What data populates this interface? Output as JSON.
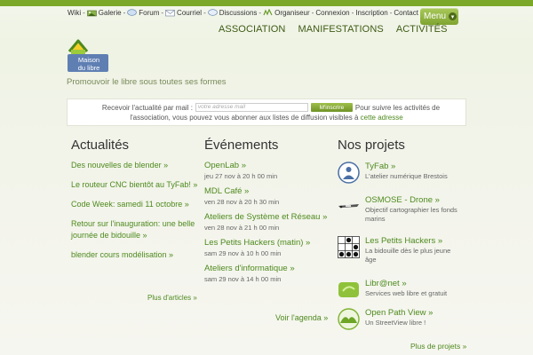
{
  "toplinks": [
    {
      "label": "Wiki",
      "icon": null
    },
    {
      "label": "Galerie",
      "icon": "gallery-icon"
    },
    {
      "label": "Forum",
      "icon": "forum-icon"
    },
    {
      "label": "Courriel",
      "icon": "mail-icon"
    },
    {
      "label": "Discussions",
      "icon": "chat-icon"
    },
    {
      "label": "Organiseur",
      "icon": "organizer-icon"
    },
    {
      "label": "Connexion",
      "icon": null
    },
    {
      "label": "Inscription",
      "icon": null
    },
    {
      "label": "Contact",
      "icon": null
    }
  ],
  "menu_label": "Menu",
  "nav": [
    "ASSOCIATION",
    "MANIFESTATIONS",
    "ACTIVITÉS"
  ],
  "logo": {
    "line1": "Maison",
    "line2": "du libre"
  },
  "tagline": "Promouvoir le libre sous toutes ses formes",
  "newsletter": {
    "label": "Recevoir l'actualité par mail :",
    "placeholder": "votre adresse mail",
    "button": "M'inscrire",
    "text_after": "Pour suivre les activités de",
    "text_line2": "l'association, vous pouvez vous abonner aux listes de diffusion visibles à",
    "link": "cette adresse"
  },
  "news": {
    "title": "Actualités",
    "items": [
      "Des nouvelles de blender »",
      "Le routeur CNC bientôt au TyFab! »",
      "Code Week: samedi 11 octobre »",
      "Retour sur l'inauguration: une belle journée de bidouille »",
      "blender cours modélisation »"
    ],
    "more": "Plus d'articles »"
  },
  "events": {
    "title": "Événements",
    "items": [
      {
        "title": "OpenLab »",
        "date": "jeu 27 nov à 20 h 00 min"
      },
      {
        "title": "MDL Café »",
        "date": "ven 28 nov à 20 h 30 min"
      },
      {
        "title": "Ateliers de Système et Réseau »",
        "date": "ven 28 nov à 21 h 00 min"
      },
      {
        "title": "Les Petits Hackers (matin) »",
        "date": "sam 29 nov à 10 h 00 min"
      },
      {
        "title": "Ateliers d'informatique »",
        "date": "sam 29 nov à 14 h 00 min"
      }
    ],
    "more": "Voir l'agenda »"
  },
  "projects": {
    "title": "Nos projets",
    "items": [
      {
        "title": "TyFab »",
        "desc": "L'atelier numérique Brestois",
        "icon": "tyfab-icon"
      },
      {
        "title": "OSMOSE - Drone »",
        "desc": "Objectif cartographier les fonds marins",
        "icon": "drone-icon"
      },
      {
        "title": "Les Petits Hackers »",
        "desc": "La bidouille dès le plus jeune âge",
        "icon": "glider-icon"
      },
      {
        "title": "Libr@net »",
        "desc": "Services web libre et gratuit",
        "icon": "librenet-icon"
      },
      {
        "title": "Open Path View »",
        "desc": "Un StreetView libre !",
        "icon": "openpathview-icon"
      }
    ],
    "more": "Plus de projets »"
  },
  "colors": {
    "accent": "#7ca829",
    "link": "#4e8a1e"
  }
}
